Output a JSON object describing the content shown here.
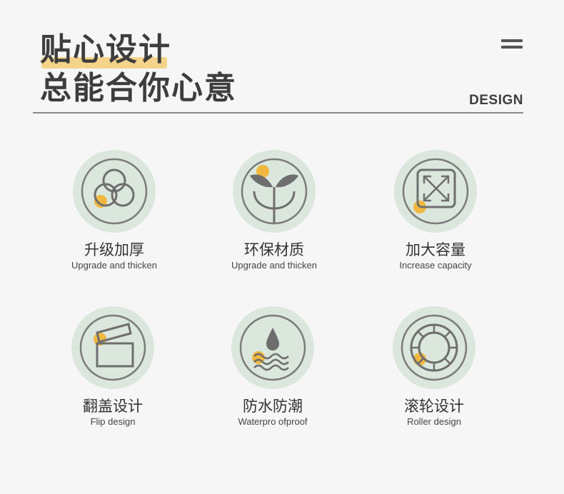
{
  "header": {
    "title_line1": "贴心设计",
    "title_line2": "总能合你心意",
    "design_label": "DESIGN",
    "menu_icon": "hamburger-icon",
    "highlight_color": "#f3d48a"
  },
  "features": [
    {
      "zh": "升级加厚",
      "en": "Upgrade and thicken",
      "icon": "thicken-circles-icon"
    },
    {
      "zh": "环保材质",
      "en": "Upgrade and thicken",
      "icon": "leaf-sprout-icon"
    },
    {
      "zh": "加大容量",
      "en": "Increase capacity",
      "icon": "expand-arrows-icon"
    },
    {
      "zh": "翻盖设计",
      "en": "Flip design",
      "icon": "flip-lid-icon"
    },
    {
      "zh": "防水防潮",
      "en": "Waterpro ofproof",
      "icon": "water-drop-icon"
    },
    {
      "zh": "滚轮设计",
      "en": "Roller design",
      "icon": "roller-wheel-icon"
    }
  ],
  "colors": {
    "disc": "#dbe6dd",
    "icon_stroke": "#7b7b7b",
    "accent_dot": "#f0b83e"
  }
}
